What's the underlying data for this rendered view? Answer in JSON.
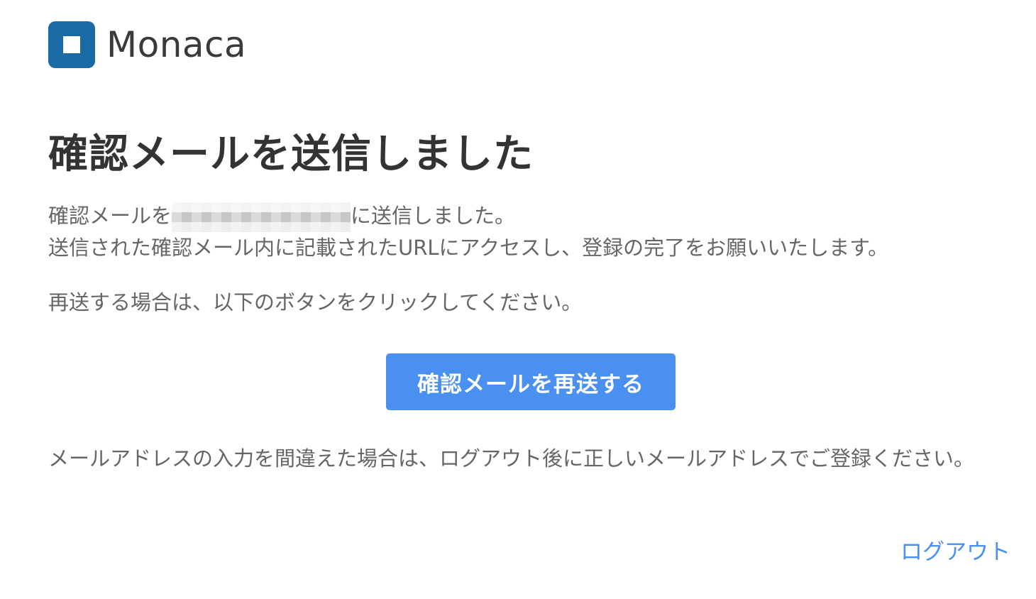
{
  "header": {
    "logo_text": "Monaca"
  },
  "main": {
    "title": "確認メールを送信しました",
    "message_line1_prefix": "確認メールを",
    "message_line1_suffix": "に送信しました。",
    "message_line2": "送信された確認メール内に記載されたURLにアクセスし、登録の完了をお願いいたします。",
    "resend_note": "再送する場合は、以下のボタンをクリックしてください。",
    "resend_button_label": "確認メールを再送する",
    "mistake_note": "メールアドレスの入力を間違えた場合は、ログアウト後に正しいメールアドレスでご登録ください。",
    "logout_label": "ログアウト"
  },
  "colors": {
    "brand": "#1a6aa6",
    "primary_button": "#4a90f0",
    "link": "#4a90f0",
    "title_text": "#333333",
    "body_text": "#666666"
  },
  "icons": {
    "logo": "monaca-logo-icon"
  }
}
